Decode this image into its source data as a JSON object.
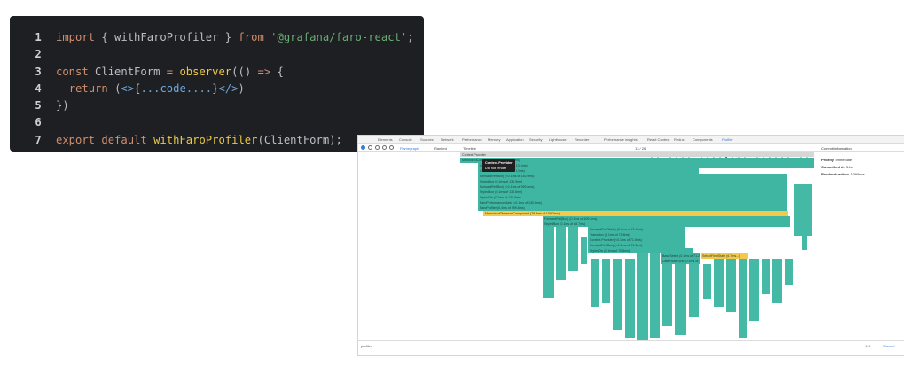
{
  "code": {
    "lines": [
      {
        "num": "1",
        "tokens": [
          {
            "t": "import ",
            "c": "kw"
          },
          {
            "t": "{ withFaroProfiler } ",
            "c": ""
          },
          {
            "t": "from ",
            "c": "kw"
          },
          {
            "t": "'@grafana/faro-react'",
            "c": "str"
          },
          {
            "t": ";",
            "c": ""
          }
        ]
      },
      {
        "num": "2",
        "tokens": []
      },
      {
        "num": "3",
        "tokens": [
          {
            "t": "const ",
            "c": "kw"
          },
          {
            "t": "ClientForm ",
            "c": ""
          },
          {
            "t": "= ",
            "c": "kw"
          },
          {
            "t": "observer",
            "c": "fn"
          },
          {
            "t": "(() ",
            "c": ""
          },
          {
            "t": "=> ",
            "c": "kw"
          },
          {
            "t": "{",
            "c": ""
          }
        ]
      },
      {
        "num": "4",
        "tokens": [
          {
            "t": "  ",
            "c": ""
          },
          {
            "t": "return ",
            "c": "kw"
          },
          {
            "t": "(",
            "c": ""
          },
          {
            "t": "<>",
            "c": "tag"
          },
          {
            "t": "{",
            "c": ""
          },
          {
            "t": "...code....",
            "c": "tag"
          },
          {
            "t": "}",
            "c": ""
          },
          {
            "t": "</>",
            "c": "tag"
          },
          {
            "t": ")",
            "c": ""
          }
        ]
      },
      {
        "num": "5",
        "tokens": [
          {
            "t": "})",
            "c": ""
          }
        ]
      },
      {
        "num": "6",
        "tokens": []
      },
      {
        "num": "7",
        "tokens": [
          {
            "t": "export ",
            "c": "kw"
          },
          {
            "t": "default ",
            "c": "kw"
          },
          {
            "t": "withFaroProfiler",
            "c": "fn"
          },
          {
            "t": "(ClientForm);",
            "c": ""
          }
        ]
      }
    ]
  },
  "devtools": {
    "tabs": [
      "Elements",
      "Console",
      "Sources",
      "Network",
      "Performance",
      "Memory",
      "Application",
      "Security",
      "Lighthouse",
      "Recorder",
      "Performance insights",
      "React Context",
      "Redux",
      "Components",
      "Profiler"
    ],
    "toolbar": {
      "flamegraph": "Flamegraph",
      "ranked": "Ranked",
      "timeline": "Timeline",
      "commit_counter": "13 / 26"
    },
    "root_label": "Context.Provider",
    "tooltip": {
      "title": "Context.Provider",
      "subtitle": "Did not render"
    },
    "bars": [
      {
        "label": "MemoizedComponent (0.3ms of 13.0ms)",
        "color": "teal"
      },
      {
        "label": "Context.Provider (0ms of 13.0ms)",
        "color": "teal"
      },
      {
        "label": "Context.Provider (0ms of 13ms)",
        "color": "teal"
      },
      {
        "label": "ForwardRef(Box) (<0.1ms of 130.9ms)",
        "color": "teal"
      },
      {
        "label": "StyledBox (0.1ms of 130.9ms)",
        "color": "teal"
      },
      {
        "label": "ForwardRef(Box) (<0.1ms of 999.8ms)",
        "color": "teal"
      },
      {
        "label": "StyledBox (0.1ms of 130.6ms)",
        "color": "teal"
      },
      {
        "label": "StyledDiv (0.1ms of 130.6ms)",
        "color": "teal"
      },
      {
        "label": "FaroPerformanceMark (<0.1ms of 130.6ms)",
        "color": "teal"
      },
      {
        "label": "FaroProfiler (0.4ms of 999.8ms)",
        "color": "teal"
      },
      {
        "label": "MemoizedObserverComponent (78.8ms of 109.2ms)",
        "color": "yellow"
      },
      {
        "label": "ForwardRef(Box) (0.1ms of 109.2ms)",
        "color": "teal"
      },
      {
        "label": "StyledBox (0.1ms of 88.7ms)",
        "color": "teal"
      },
      {
        "label": "ForwardRef(Table) (0.1ms of 71.9ms)",
        "color": "teal"
      },
      {
        "label": "Transition (0.1ms of 71.8ms)",
        "color": "teal"
      },
      {
        "label": "Context.Provider (<0.1ms of 71.5ms)",
        "color": "teal"
      },
      {
        "label": "ForwardRef(Box) (<0.1ms of 71.3ms)",
        "color": "teal"
      },
      {
        "label": "StyledDiv (0.1ms of 70.8ms)",
        "color": "teal"
      },
      {
        "label": "BaseSelect (0.1ms of 71.2ms)",
        "color": "teal"
      },
      {
        "label": "DatePickerGrid (0.1ms of...)",
        "color": "teal"
      },
      {
        "label": "SelectFieldState (6.7ms...)",
        "color": "yellow"
      }
    ],
    "side_panel": {
      "title": "Commit information",
      "priority_label": "Priority:",
      "priority_value": "Immediate",
      "committed_label": "Committed at:",
      "committed_value": "5.4s",
      "duration_label": "Render duration:",
      "duration_value": "109.9ms"
    },
    "search": {
      "value": "profiler",
      "counter": "1/1",
      "cancel": "Cancel"
    },
    "colors": {
      "teal": "#3fb6a2",
      "yellow": "#f2c94c",
      "selected": "#3a7bd5"
    }
  }
}
